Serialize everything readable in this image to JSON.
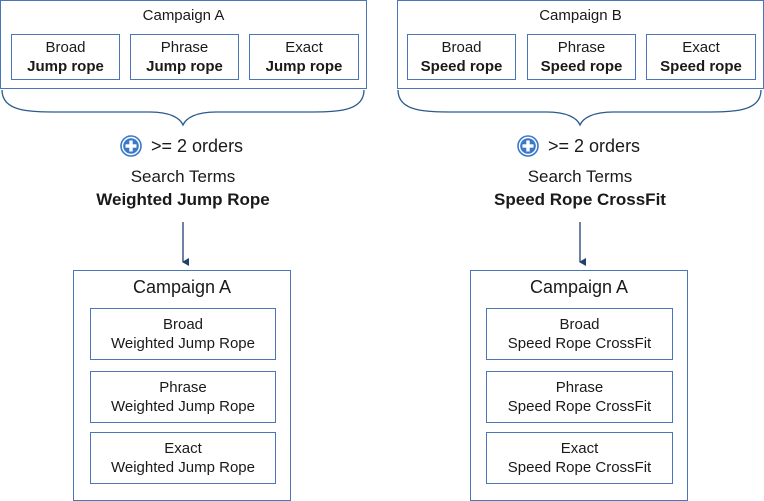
{
  "source_campaigns": [
    {
      "title": "Campaign A",
      "ad_groups": [
        {
          "match_type": "Broad",
          "keyword": "Jump rope"
        },
        {
          "match_type": "Phrase",
          "keyword": "Jump rope"
        },
        {
          "match_type": "Exact",
          "keyword": "Jump rope"
        }
      ]
    },
    {
      "title": "Campaign B",
      "ad_groups": [
        {
          "match_type": "Broad",
          "keyword": "Speed rope"
        },
        {
          "match_type": "Phrase",
          "keyword": "Speed rope"
        },
        {
          "match_type": "Exact",
          "keyword": "Speed rope"
        }
      ]
    }
  ],
  "rules": [
    {
      "icon": "plus-circle-icon",
      "condition": ">= 2 orders",
      "label": "Search Terms",
      "search_term": "Weighted Jump Rope"
    },
    {
      "icon": "plus-circle-icon",
      "condition": ">= 2 orders",
      "label": "Search Terms",
      "search_term": "Speed Rope CrossFit"
    }
  ],
  "target_campaigns": [
    {
      "title": "Campaign A",
      "ad_groups": [
        {
          "match_type": "Broad",
          "keyword": "Weighted Jump Rope"
        },
        {
          "match_type": "Phrase",
          "keyword": "Weighted Jump Rope"
        },
        {
          "match_type": "Exact",
          "keyword": "Weighted Jump Rope"
        }
      ]
    },
    {
      "title": "Campaign A",
      "ad_groups": [
        {
          "match_type": "Broad",
          "keyword": "Speed Rope CrossFit"
        },
        {
          "match_type": "Phrase",
          "keyword": "Speed Rope CrossFit"
        },
        {
          "match_type": "Exact",
          "keyword": "Speed Rope CrossFit"
        }
      ]
    }
  ],
  "colors": {
    "box_border": "#4a76b8",
    "connector": "#1f3f6e",
    "icon_fill": "#3a78c9"
  }
}
